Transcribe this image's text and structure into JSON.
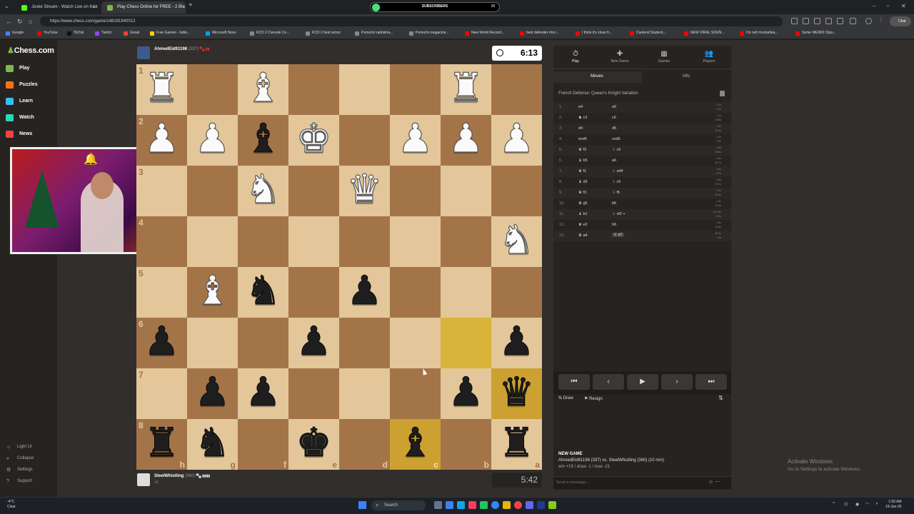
{
  "browser": {
    "tabs": [
      {
        "title": "Jovke Stream - Watch Live on Kick",
        "close": "×"
      },
      {
        "title": "Play Chess Online for FREE - 2 Pla",
        "close": "×"
      }
    ],
    "new_tab": "+",
    "subscribers_label": "SUBSCRIBERS",
    "subscribers_count": "18",
    "url": "https://www.chess.com/game/148191940012",
    "bookmarks": [
      "Google",
      "YouTube",
      "TikTok",
      "Twitch",
      "Gmail",
      "Free Games - Indie...",
      "Microsoft Store",
      "KCD 2 Console Co...",
      "KCD 2 best armor",
      "Pomoćni radnik/ra...",
      "Pomoćni magacine...",
      "New World Record...",
      "best defender #roc...",
      "I think it's close fr...",
      "Ćaolend Student,...",
      "NEW VIRAL SOUN...",
      "I'm rw9 #rocketlea...",
      "Some WEIRD Clips..."
    ],
    "chatgpt_label": "Chat"
  },
  "sidebar": {
    "logo": "Chess.com",
    "items": [
      "Play",
      "Puzzles",
      "Learn",
      "Watch",
      "News"
    ],
    "bottom": [
      "Light UI",
      "Collapse",
      "Settings",
      "Support"
    ]
  },
  "top_player": {
    "name": "AhmedEid91198",
    "rating": "(337)",
    "flags": "▀▄ ▮▮",
    "clock": "6:13"
  },
  "bottom_player": {
    "name": "SteelWhistling",
    "rating": "(360)",
    "flags": "▀▄ ▮▮▮▮",
    "clock": "5:42",
    "sub": "+2"
  },
  "board": {
    "ranks": [
      "1",
      "2",
      "3",
      "4",
      "5",
      "6",
      "7",
      "8"
    ],
    "files": [
      "h",
      "g",
      "f",
      "e",
      "d",
      "c",
      "b",
      "a"
    ],
    "rows": [
      [
        "wR",
        "",
        "wB",
        "",
        "",
        "",
        "wR",
        ""
      ],
      [
        "wP",
        "wP",
        "bB",
        "wK",
        "",
        "wP",
        "wP",
        "wP"
      ],
      [
        "",
        "",
        "wN",
        "",
        "wQ",
        "",
        "",
        ""
      ],
      [
        "",
        "",
        "",
        "",
        "",
        "",
        "",
        "wN"
      ],
      [
        "",
        "wB",
        "bN",
        "",
        "bP",
        "",
        "",
        ""
      ],
      [
        "bP",
        "",
        "",
        "bP",
        "",
        "",
        "",
        "bP"
      ],
      [
        "",
        "bP",
        "bP",
        "",
        "",
        "",
        "bP",
        "bQ"
      ],
      [
        "bR",
        "bN",
        "",
        "bK",
        "",
        "bB",
        "",
        "bR"
      ]
    ],
    "highlighted": [
      "5,6",
      "6,7",
      "7,5"
    ]
  },
  "panel": {
    "tabs": [
      {
        "label": "Play",
        "icon": "⏱"
      },
      {
        "label": "New Game",
        "icon": "✚"
      },
      {
        "label": "Games",
        "icon": "▦"
      },
      {
        "label": "Players",
        "icon": "👥"
      }
    ],
    "subtabs": [
      "Moves",
      "Info"
    ],
    "opening": "French Defense: Queen's Knight Variation",
    "moves": [
      {
        "n": "1.",
        "w": "e4",
        "b": "e6",
        "tw": "0.7s",
        "tb": "1.3s"
      },
      {
        "n": "2.",
        "w": "♞ c3",
        "b": "c6",
        "tw": "1.1s",
        "tb": "10.8s"
      },
      {
        "n": "3.",
        "w": "d4",
        "b": "d5",
        "tw": "1.5s",
        "tb": "19.2s"
      },
      {
        "n": "4.",
        "w": "exd5",
        "b": "cxd5",
        "tw": "1.2s",
        "tb": "2.5s"
      },
      {
        "n": "5.",
        "w": "♛ f3",
        "b": "♘ c6",
        "tw": "4.4s",
        "tb": "29.8s"
      },
      {
        "n": "6.",
        "w": "♝ b5",
        "b": "a6",
        "tw": "2.6s",
        "tb": "16.7s"
      },
      {
        "n": "7.",
        "w": "♛ f1",
        "b": "♘ xd4",
        "tw": "2.6s",
        "tb": "5.7s"
      },
      {
        "n": "8.",
        "w": "♝ d3",
        "b": "♘ c5",
        "tw": "6.9s",
        "tb": "37.0s"
      },
      {
        "n": "9.",
        "w": "♛ f3",
        "b": "♘ f5",
        "tw": "2.4s",
        "tb": "33.4s"
      },
      {
        "n": "10.",
        "w": "♛ g5",
        "b": "b6",
        "tw": "1.4s",
        "tb": "11.4s"
      },
      {
        "n": "11.",
        "w": "♝ b1",
        "b": "♘ xf2 +",
        "tw": "1m 10s",
        "tb": "6.0s"
      },
      {
        "n": "12.",
        "w": "♛ e2",
        "b": "h6",
        "tw": "1.6s",
        "tb": "20.5s"
      },
      {
        "n": "13.",
        "w": "♛ a4",
        "b": "♕ a7",
        "tw": "30.4s",
        "tb": "1.4s"
      }
    ],
    "controls": [
      "⏮",
      "‹",
      "▶",
      "›",
      "⏭"
    ],
    "actions": {
      "draw_icon": "½",
      "draw": "Draw",
      "resign_icon": "⚑",
      "resign": "Resign",
      "flip_icon": "⇅"
    },
    "new_game_title": "NEW GAME",
    "new_game_line1": "AhmedEid91198 (337) vs. SteelWhistling (360) (10 min)",
    "new_game_line2": "win +19 / draw -1 / lose -21",
    "chat_placeholder": "Send a message...",
    "chat_icons": "☺ ⋯"
  },
  "watermark": {
    "title": "Activate Windows",
    "sub": "Go to Settings to activate Windows."
  },
  "taskbar": {
    "weather_temp": "-4°C",
    "weather_text": "Clear",
    "search": "Search",
    "time": "1:50 AM",
    "date": "19-Jan-26"
  },
  "colors": {
    "light_square": "#e3c79a",
    "dark_square": "#a47449",
    "highlight": "#cda032",
    "brand_green": "#81b64c"
  }
}
